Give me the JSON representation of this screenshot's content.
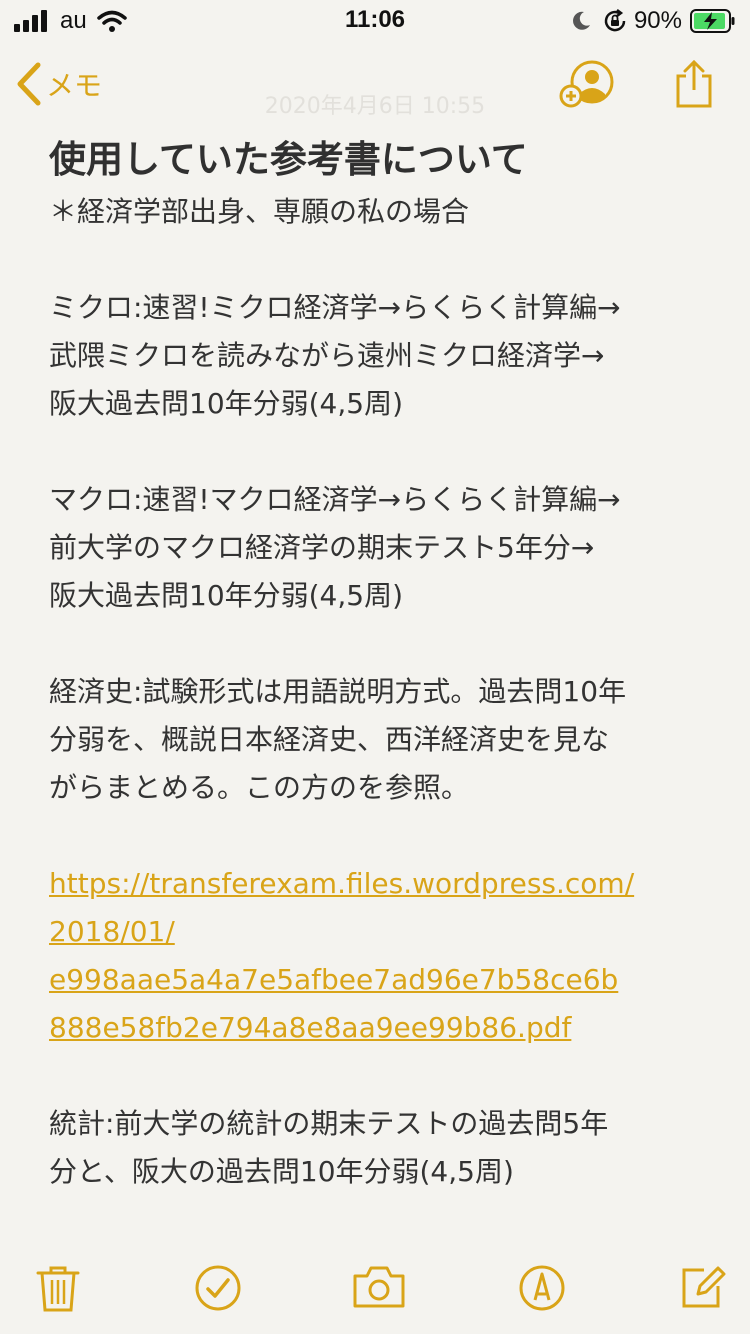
{
  "status_bar": {
    "carrier": "au",
    "time": "11:06",
    "battery": "90%"
  },
  "nav": {
    "back_label": "メモ",
    "date": "2020年4月6日 10:55"
  },
  "note": {
    "title": "使用していた参考書について",
    "subtitle": "＊経済学部出身、専願の私の場合",
    "micro": [
      "ミクロ:速習!ミクロ経済学→らくらく計算編→",
      "武隈ミクロを読みながら遠州ミクロ経済学→",
      "阪大過去問10年分弱(4,5周)"
    ],
    "macro": [
      "マクロ:速習!マクロ経済学→らくらく計算編→",
      "前大学のマクロ経済学の期末テスト5年分→",
      "阪大過去問10年分弱(4,5周)"
    ],
    "history": [
      "経済史:試験形式は用語説明方式。過去問10年",
      "分弱を、概説日本経済史、西洋経済史を見な",
      "がらまとめる。この方のを参照。"
    ],
    "link": [
      "https://transferexam.files.wordpress.com/",
      "2018/01/",
      "e998aae5a4a7e5afbee7ad96e7b58ce6b",
      "888e58fb2e794a8e8aa9ee99b86.pdf"
    ],
    "stats": [
      "統計:前大学の統計の期末テストの過去問5年",
      "分と、阪大の過去問10年分弱(4,5周)"
    ]
  },
  "toolbar": {
    "icons": [
      "trash-icon",
      "checklist-icon",
      "camera-icon",
      "markup-icon",
      "compose-icon"
    ]
  },
  "colors": {
    "accent": "#d9a418",
    "background": "#f4f3ef",
    "text": "#333333"
  }
}
